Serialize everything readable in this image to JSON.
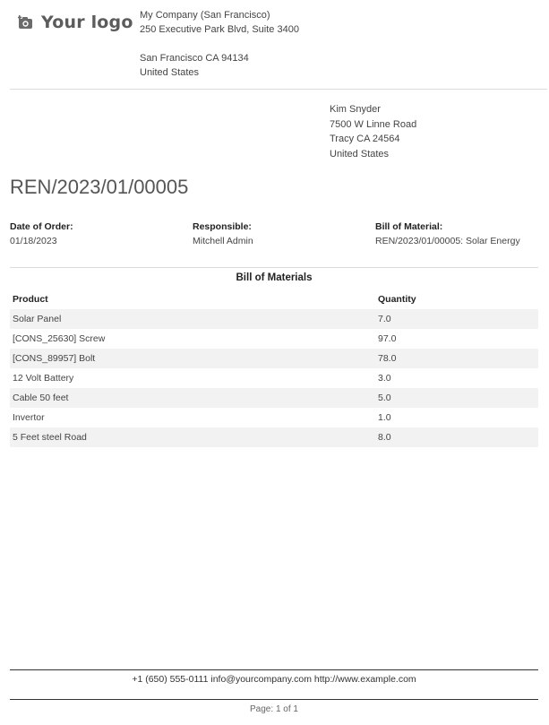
{
  "logo": {
    "icon": "camera-plus-icon",
    "text": "Your logo"
  },
  "company": {
    "name": "My Company (San Francisco)",
    "street": "250 Executive Park Blvd, Suite 3400",
    "city_line": "San Francisco CA 94134",
    "country": "United States"
  },
  "recipient": {
    "name": "Kim Snyder",
    "street": "7500 W Linne Road",
    "city_line": "Tracy CA 24564",
    "country": "United States"
  },
  "document": {
    "title": "REN/2023/01/00005"
  },
  "info": {
    "date_label": "Date of Order:",
    "date_value": "01/18/2023",
    "responsible_label": "Responsible:",
    "responsible_value": "Mitchell Admin",
    "bom_label": "Bill of Material:",
    "bom_value": "REN/2023/01/00005: Solar Energy"
  },
  "bom_table": {
    "heading": "Bill of Materials",
    "headers": {
      "product": "Product",
      "quantity": "Quantity"
    },
    "rows": [
      {
        "product": "Solar Panel",
        "quantity": "7.0"
      },
      {
        "product": "[CONS_25630] Screw",
        "quantity": "97.0"
      },
      {
        "product": "[CONS_89957] Bolt",
        "quantity": "78.0"
      },
      {
        "product": "12 Volt Battery",
        "quantity": "3.0"
      },
      {
        "product": "Cable 50 feet",
        "quantity": "5.0"
      },
      {
        "product": "Invertor",
        "quantity": "1.0"
      },
      {
        "product": "5 Feet steel Road",
        "quantity": "8.0"
      }
    ]
  },
  "footer": {
    "contact": "+1 (650) 555-0111 info@yourcompany.com http://www.example.com",
    "page_prefix": "Page:",
    "page_current": "1",
    "page_of": "of",
    "page_total": "1"
  }
}
